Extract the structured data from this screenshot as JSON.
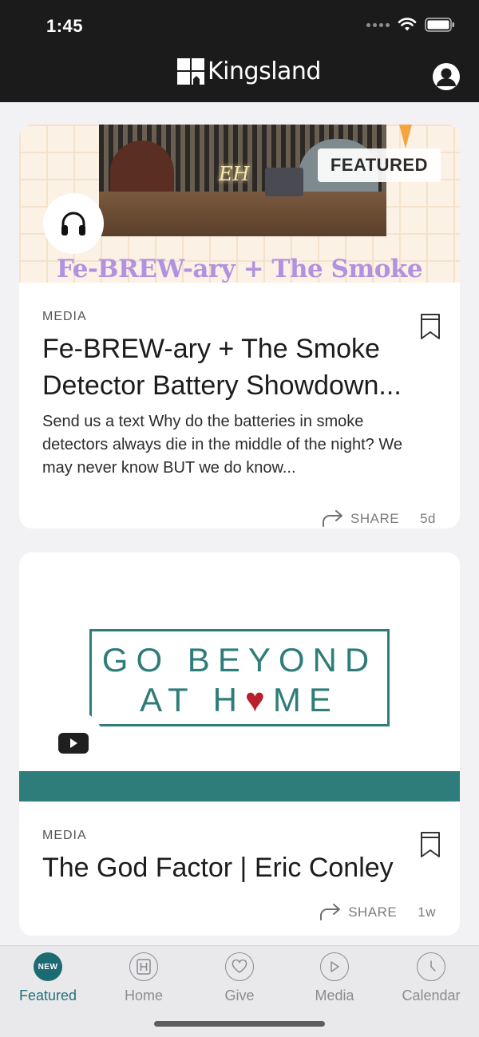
{
  "status_bar": {
    "time": "1:45"
  },
  "header": {
    "brand": "Kingsland"
  },
  "feed": {
    "cards": [
      {
        "banner_text": "Fe-BREW-ary + The Smoke",
        "badge": "FEATURED",
        "media_icon": "headphones-icon",
        "category": "MEDIA",
        "title": "Fe-BREW-ary + The Smoke Detector Battery Showdown...",
        "excerpt": "Send us a text Why do the batteries in smoke detectors always die in the middle of the night? We may never know BUT we do know...",
        "share_label": "SHARE",
        "age": "5d"
      },
      {
        "art_line1": "GO BEYOND",
        "art_line2_a": "AT H",
        "art_line2_b": "ME",
        "media_icon": "youtube-play-icon",
        "category": "MEDIA",
        "title": "The God Factor | Eric Conley",
        "share_label": "SHARE",
        "age": "1w"
      }
    ]
  },
  "tabbar": {
    "tabs": [
      {
        "label": "Featured",
        "badge": "NEW",
        "icon": "new-badge-icon",
        "active": true
      },
      {
        "label": "Home",
        "icon": "home-h-icon"
      },
      {
        "label": "Give",
        "icon": "heart-icon"
      },
      {
        "label": "Media",
        "icon": "play-icon"
      },
      {
        "label": "Calendar",
        "icon": "clock-icon"
      }
    ]
  },
  "colors": {
    "accent": "#1d6b72",
    "brand_teal": "#2f7d7a",
    "banner_purple": "#b291e0",
    "header_bg": "#1b1b1b"
  }
}
